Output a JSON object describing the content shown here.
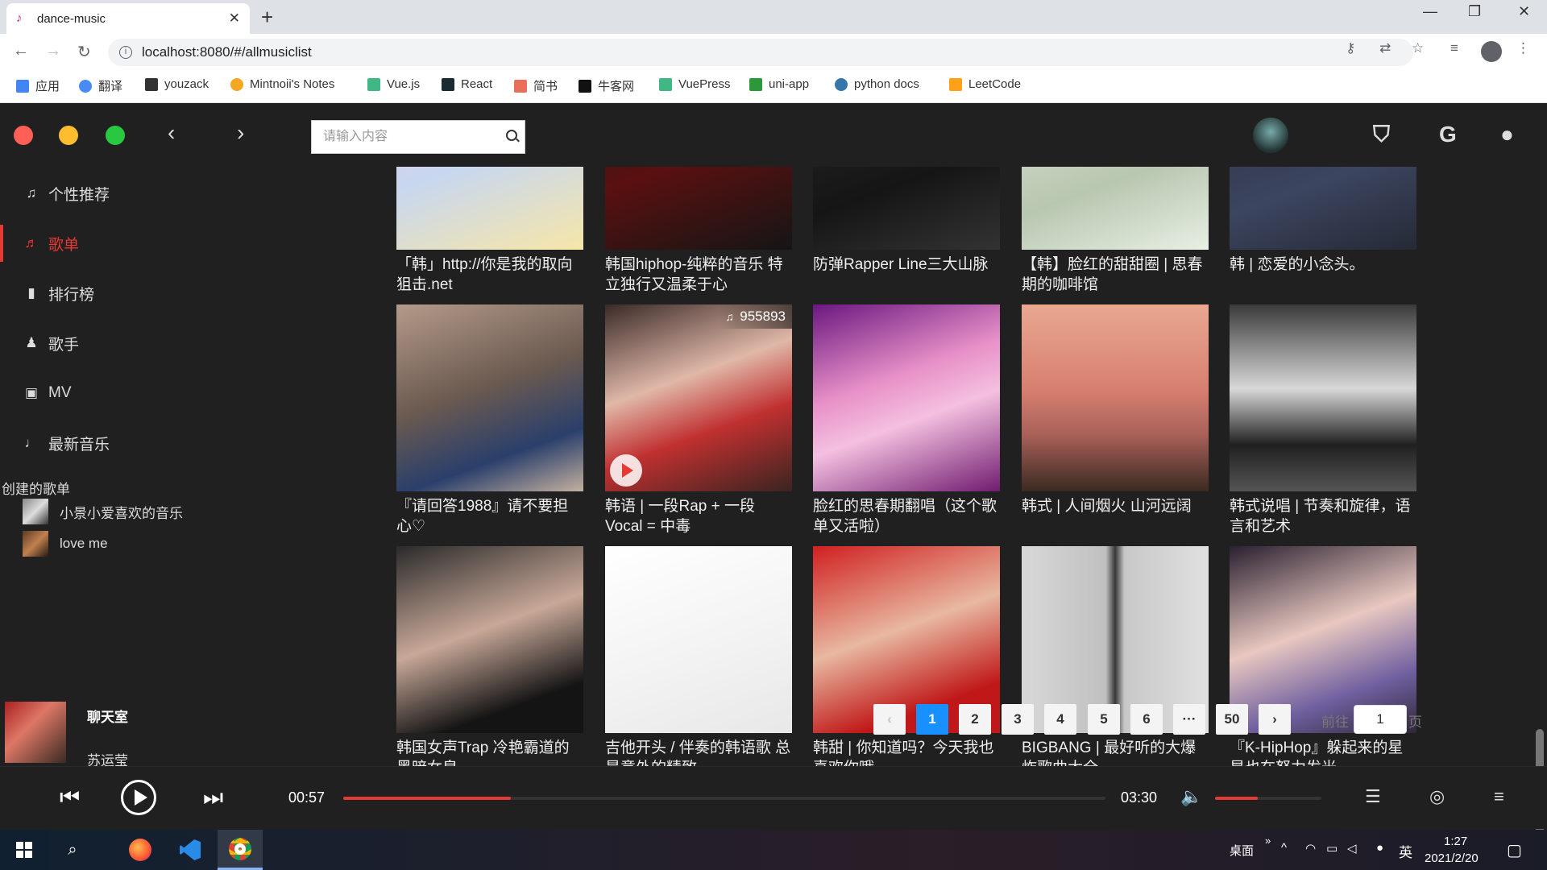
{
  "browser": {
    "tab_title": "dance-music",
    "url": "localhost:8080/#/allmusiclist",
    "bookmarks": [
      {
        "label": "应用",
        "color": "#4285f4"
      },
      {
        "label": "翻译",
        "color": "#4a8af4"
      },
      {
        "label": "youzack",
        "color": "#333333"
      },
      {
        "label": "Mintnoii's Notes",
        "color": "#f5a623"
      },
      {
        "label": "Vue.js",
        "color": "#41b883"
      },
      {
        "label": "React",
        "color": "#1a2b34"
      },
      {
        "label": "简书",
        "color": "#ea6f5a"
      },
      {
        "label": "牛客网",
        "color": "#111111"
      },
      {
        "label": "VuePress",
        "color": "#41b883"
      },
      {
        "label": "uni-app",
        "color": "#2b9939"
      },
      {
        "label": "python docs",
        "color": "#3776ab"
      },
      {
        "label": "LeetCode",
        "color": "#ffa116"
      }
    ]
  },
  "app": {
    "search_placeholder": "请输入内容",
    "nav": [
      {
        "label": "个性推荐",
        "icon": "music-note-icon",
        "glyph": "♫",
        "active": false
      },
      {
        "label": "歌单",
        "icon": "playlist-icon",
        "glyph": "♬",
        "active": true
      },
      {
        "label": "排行榜",
        "icon": "bar-chart-icon",
        "glyph": "▮",
        "active": false
      },
      {
        "label": "歌手",
        "icon": "person-icon",
        "glyph": "♟",
        "active": false
      },
      {
        "label": "MV",
        "icon": "video-icon",
        "glyph": "▣",
        "active": false
      },
      {
        "label": "最新音乐",
        "icon": "music-icon",
        "glyph": "♩",
        "active": false
      }
    ],
    "created_title": "创建的歌单",
    "created_playlists": [
      {
        "label": "小景小爱喜欢的音乐"
      },
      {
        "label": "love me"
      }
    ],
    "now_playing": {
      "title": "聊天室",
      "artist": "苏运莹"
    },
    "playlists": [
      {
        "name": "「韩」http://你是我的取向狙击.net",
        "cover": "linear-gradient(160deg,#f2c6d8,#c8d7f0 50%,#f6e6a8)"
      },
      {
        "name": "韩国hiphop-纯粹的音乐 特立独行又温柔于心",
        "cover": "linear-gradient(160deg,#1b1b1b,#5a1010 50%,#151515)"
      },
      {
        "name": "防弹Rapper Line三大山脉",
        "cover": "linear-gradient(160deg,#2a2a2a,#151515 60%,#333)"
      },
      {
        "name": "【韩】脸红的甜甜圈 | 思春期的咖啡馆",
        "cover": "linear-gradient(160deg,#dfe6d8,#b8c7b0 60%,#e8efe4)"
      },
      {
        "name": "韩 | 恋爱的小念头。",
        "cover": "linear-gradient(160deg,#2a2f3e,#3c4560 60%,#262a36)"
      },
      {
        "name": "『请回答1988』请不要担心♡",
        "cover": "linear-gradient(160deg,#b49a8a,#6b5a50 45%,#2a3f6b 75%,#c4b0a0)",
        "play_count": "",
        "has_play": false
      },
      {
        "name": "韩语 | 一段Rap + 一段Vocal = 中毒",
        "cover": "linear-gradient(160deg,#3a2a28,#e0b8a8 40%,#c03030 65%,#3a2420)",
        "play_count": "955893",
        "has_play": true
      },
      {
        "name": "脸红的思春期翻唱（这个歌单又活啦）",
        "cover": "linear-gradient(160deg,#6a1880,#e890c8 40%,#f4c0e0 60%,#701c70)",
        "play_count": "",
        "has_play": false
      },
      {
        "name": "韩式 | 人间烟火 山河远阔",
        "cover": "linear-gradient(180deg,#e8a890,#d88070 45%,#a86058 70%,#3a2a20)",
        "play_count": "",
        "has_play": false
      },
      {
        "name": "韩式说唱 | 节奏和旋律，语言和艺术",
        "cover": "linear-gradient(180deg,#3a3a3a,#d8d8d8 45%,#202020 75%,#555)",
        "play_count": "",
        "has_play": false
      },
      {
        "name": "韩国女声Trap 冷艳霸道的黑暗女皇",
        "cover": "linear-gradient(160deg,#2a2a2a,#c8a898 45%,#141414 80%)",
        "play_count": "",
        "has_play": false
      },
      {
        "name": "吉他开头 / 伴奏的韩语歌 总是意外的精致",
        "cover": "linear-gradient(160deg,#ffffff,#f4f4f4 50%,#e8e8e8)",
        "play_count": "",
        "has_play": false
      },
      {
        "name": "韩甜 | 你知道吗？今天我也喜欢你哦",
        "cover": "linear-gradient(160deg,#d02020,#e8b8a0 45%,#c01818 80%)",
        "play_count": "",
        "has_play": false
      },
      {
        "name": "BIGBANG | 最好听的大爆炸歌曲大全",
        "cover": "linear-gradient(90deg,#d8d8d8,#c0c0c0 45%,#383838 50%,#c8c8c8 55%,#e0e0e0)",
        "play_count": "",
        "has_play": false
      },
      {
        "name": "『K-HipHop』躲起来的星星也在努力发光",
        "cover": "linear-gradient(160deg,#2a2030,#e8c8c0 45%,#7060a0 75%,#302838)",
        "play_count": "",
        "has_play": false
      }
    ],
    "pagination": {
      "prev": "‹",
      "pages": [
        "1",
        "2",
        "3",
        "4",
        "5",
        "6",
        "···",
        "50"
      ],
      "next": "›",
      "goto_label": "前往",
      "goto_value": "1",
      "page_label": "页"
    },
    "player": {
      "current_time": "00:57",
      "total_time": "03:30",
      "progress": 0.22,
      "volume": 0.4
    }
  },
  "taskbar": {
    "desktop_label": "桌面",
    "ime_label": "英",
    "time": "1:27",
    "date": "2021/2/20"
  },
  "colors": {
    "accent": "#e53935",
    "pager_active": "#1890ff",
    "bg": "#202020"
  }
}
